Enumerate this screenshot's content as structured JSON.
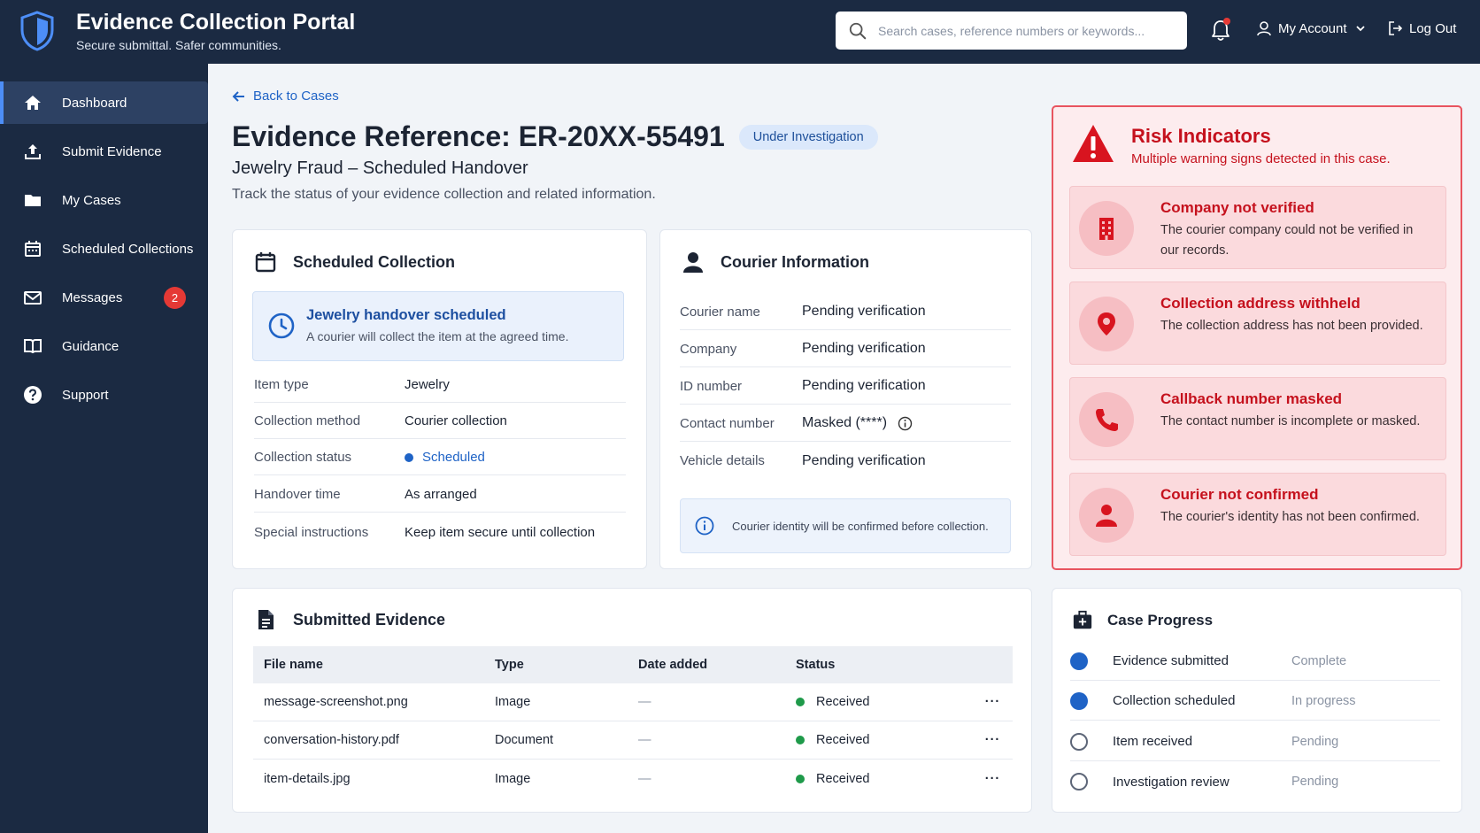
{
  "header": {
    "title": "Evidence Collection Portal",
    "subtitle": "Secure submittal. Safer communities.",
    "search_placeholder": "Search cases, reference numbers or keywords...",
    "account_label": "My Account",
    "logout_label": "Log Out"
  },
  "sidebar": {
    "items": [
      {
        "label": "Dashboard",
        "icon": "home-icon"
      },
      {
        "label": "Submit Evidence",
        "icon": "upload-icon"
      },
      {
        "label": "My Cases",
        "icon": "folder-icon"
      },
      {
        "label": "Scheduled Collections",
        "icon": "calendar-icon"
      },
      {
        "label": "Messages",
        "icon": "mail-icon",
        "badge": "2"
      },
      {
        "label": "Guidance",
        "icon": "book-icon"
      },
      {
        "label": "Support",
        "icon": "help-icon"
      }
    ]
  },
  "page": {
    "back_label": "Back to Cases",
    "title": "Evidence Reference: ER-20XX-55491",
    "status": "Under Investigation",
    "subtitle": "Jewelry Fraud – Scheduled Handover",
    "description": "Track the status of your evidence collection and related information."
  },
  "scheduled": {
    "title": "Scheduled Collection",
    "note_title": "Jewelry handover scheduled",
    "note_body": "A courier will collect the item at the agreed time.",
    "rows": [
      {
        "label": "Item type",
        "value": "Jewelry"
      },
      {
        "label": "Collection method",
        "value": "Courier collection"
      },
      {
        "label": "Collection status",
        "value": "Scheduled"
      },
      {
        "label": "Handover time",
        "value": "As arranged"
      },
      {
        "label": "Special instructions",
        "value": "Keep item secure until collection"
      }
    ]
  },
  "courier": {
    "title": "Courier Information",
    "rows": [
      {
        "label": "Courier name",
        "value": "Pending verification"
      },
      {
        "label": "Company",
        "value": "Pending verification"
      },
      {
        "label": "ID number",
        "value": "Pending verification"
      },
      {
        "label": "Contact number",
        "value": "Masked (****)"
      },
      {
        "label": "Vehicle details",
        "value": "Pending verification"
      }
    ],
    "info": "Courier identity will be confirmed before collection."
  },
  "risk": {
    "title": "Risk Indicators",
    "subtitle": "Multiple warning signs detected in this case.",
    "items": [
      {
        "title": "Company not verified",
        "body": "The courier company could not be verified in our records.",
        "icon": "building-icon"
      },
      {
        "title": "Collection address withheld",
        "body": "The collection address has not been provided.",
        "icon": "location-pin-icon"
      },
      {
        "title": "Callback number masked",
        "body": "The contact number is incomplete or masked.",
        "icon": "phone-icon"
      },
      {
        "title": "Courier not confirmed",
        "body": "The courier's identity has not been confirmed.",
        "icon": "person-icon"
      }
    ],
    "colors": {
      "accent": "#c5111d",
      "background": "#fdecee",
      "border": "#e8545f"
    }
  },
  "evidence": {
    "title": "Submitted Evidence",
    "columns": [
      "File name",
      "Type",
      "Date added",
      "Status"
    ],
    "rows": [
      {
        "file": "message-screenshot.png",
        "type": "Image",
        "date": "—",
        "status": "Received"
      },
      {
        "file": "conversation-history.pdf",
        "type": "Document",
        "date": "—",
        "status": "Received"
      },
      {
        "file": "item-details.jpg",
        "type": "Image",
        "date": "—",
        "status": "Received"
      }
    ],
    "more_label": "···"
  },
  "progress": {
    "title": "Case Progress",
    "steps": [
      {
        "label": "Evidence submitted",
        "state": "Complete",
        "done": true
      },
      {
        "label": "Collection scheduled",
        "state": "In progress",
        "done": true
      },
      {
        "label": "Item received",
        "state": "Pending",
        "done": false
      },
      {
        "label": "Investigation review",
        "state": "Pending",
        "done": false
      }
    ]
  },
  "colors": {
    "navy": "#1b2a42",
    "accent_blue": "#1f63c6",
    "success": "#1f9a4a",
    "danger": "#e53935"
  }
}
